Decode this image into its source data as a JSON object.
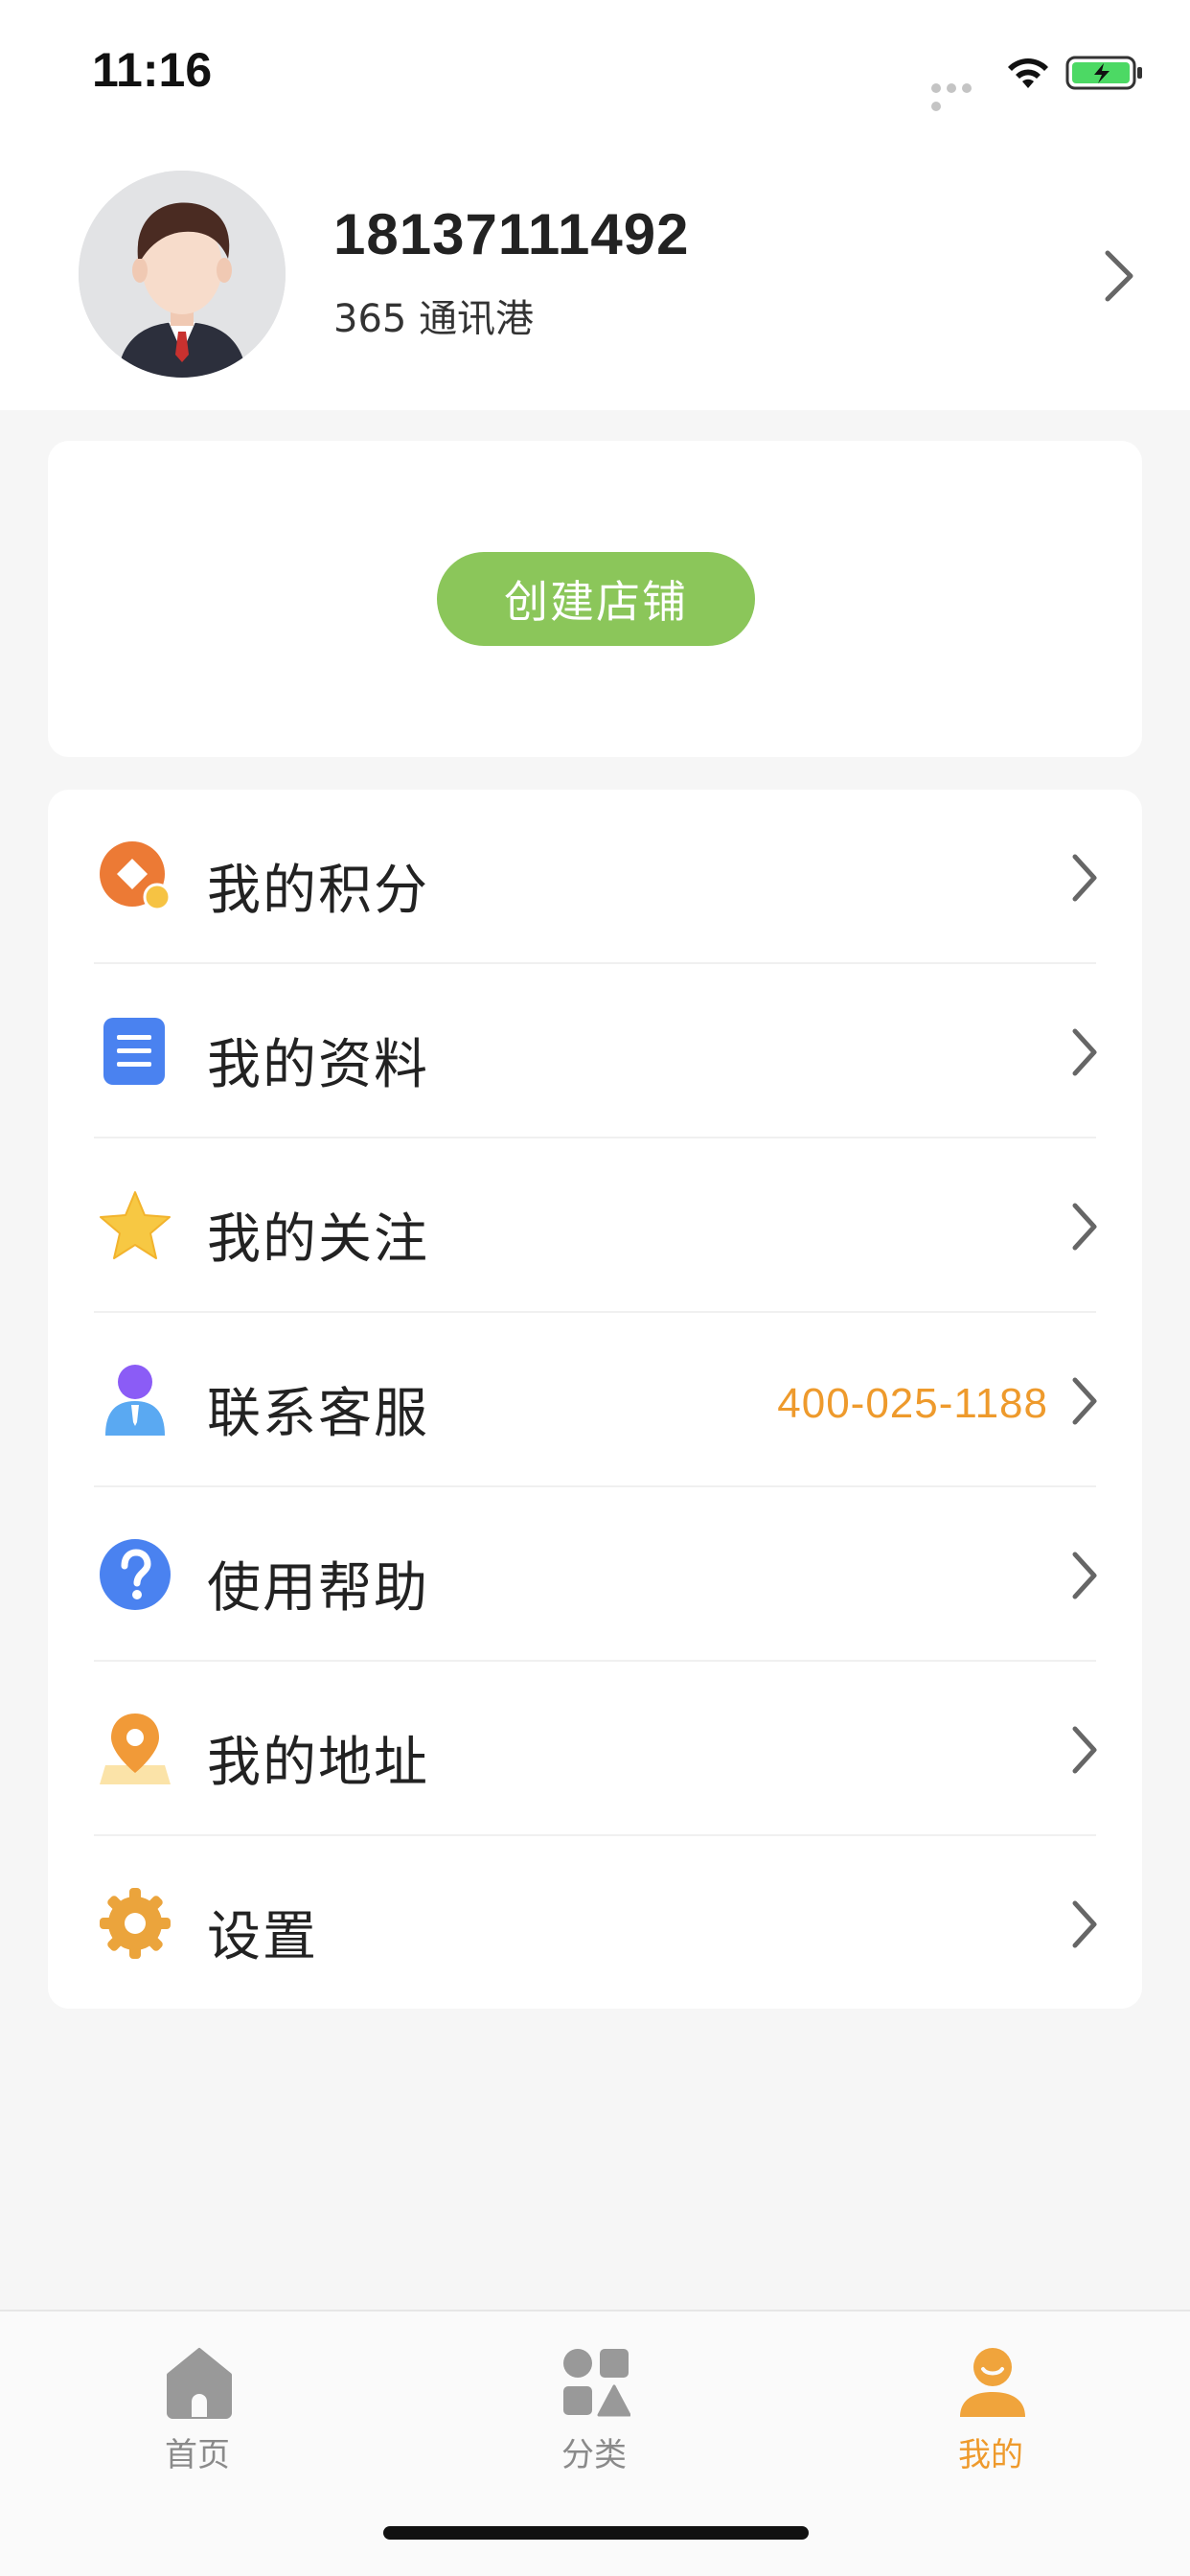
{
  "status_bar": {
    "time": "11:16"
  },
  "profile": {
    "phone": "18137111492",
    "shop_name": "365 通讯港"
  },
  "create_store": {
    "label": "创建店铺",
    "color": "#8bc65a"
  },
  "menu": [
    {
      "label": "我的积分",
      "icon": "points-icon",
      "value": ""
    },
    {
      "label": "我的资料",
      "icon": "document-icon",
      "value": ""
    },
    {
      "label": "我的关注",
      "icon": "star-icon",
      "value": ""
    },
    {
      "label": "联系客服",
      "icon": "customer-service-icon",
      "value": "400-025-1188"
    },
    {
      "label": "使用帮助",
      "icon": "help-icon",
      "value": ""
    },
    {
      "label": "我的地址",
      "icon": "location-icon",
      "value": ""
    },
    {
      "label": "设置",
      "icon": "gear-icon",
      "value": ""
    }
  ],
  "tabs": [
    {
      "label": "首页",
      "icon": "home-icon",
      "active": false
    },
    {
      "label": "分类",
      "icon": "category-icon",
      "active": false
    },
    {
      "label": "我的",
      "icon": "profile-icon",
      "active": true
    }
  ],
  "colors": {
    "accent": "#ee9a2c",
    "create_button": "#8bc65a",
    "background": "#f6f6f6"
  }
}
